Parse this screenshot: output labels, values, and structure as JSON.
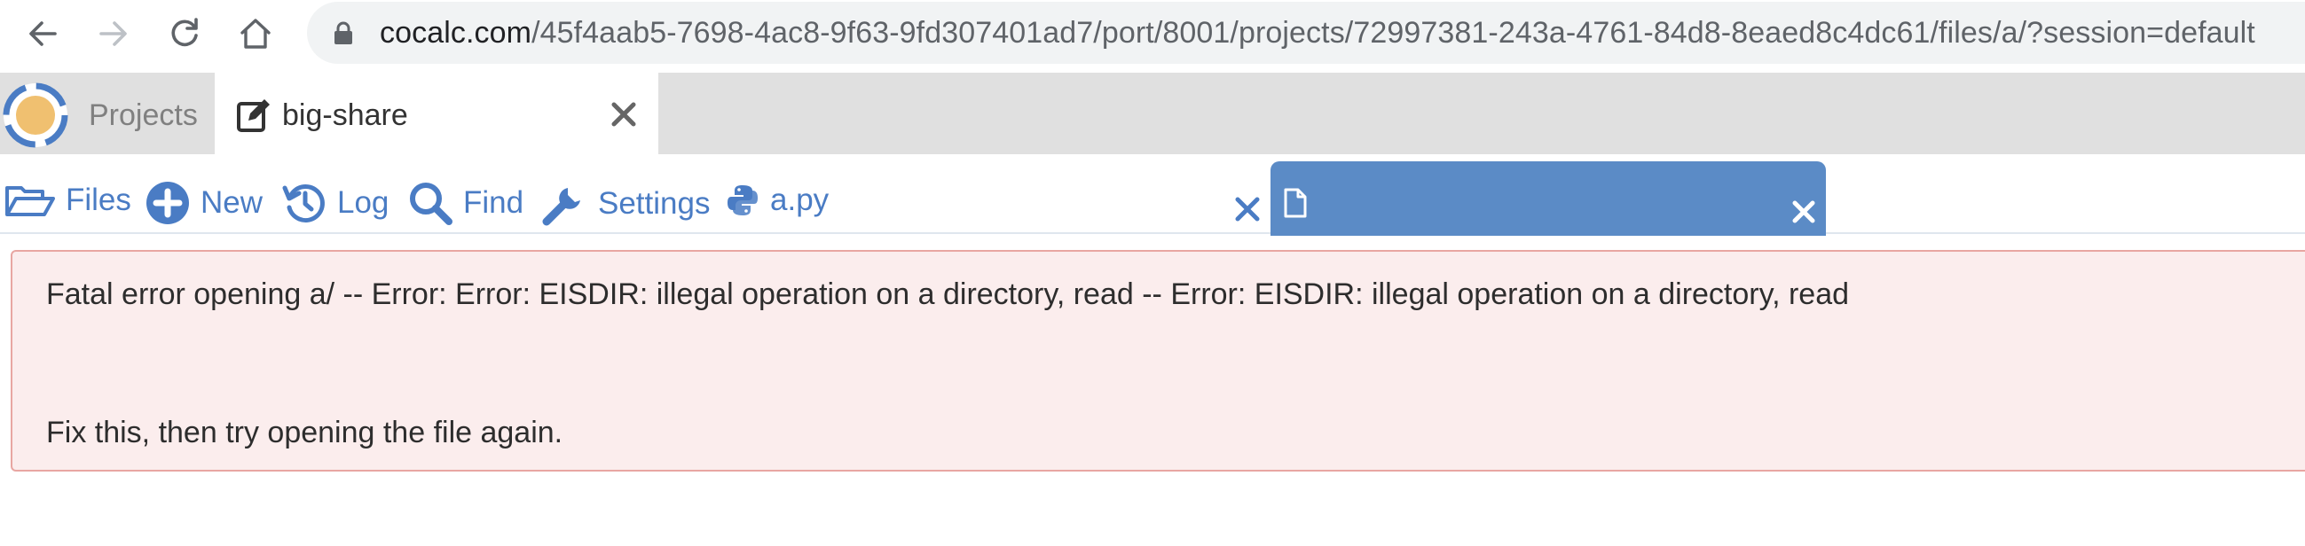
{
  "browser": {
    "url_host": "cocalc.com",
    "url_path": "/45f4aab5-7698-4ac8-9f63-9fd307401ad7/port/8001/projects/72997381-243a-4761-84d8-8eaed8c4dc61/files/a/?session=default",
    "icons": [
      "back-arrow-icon",
      "forward-arrow-icon",
      "reload-icon",
      "home-icon",
      "lock-icon"
    ]
  },
  "app_tabs": {
    "projects_label": "Projects",
    "project_tab_label": "big-share"
  },
  "toolbar": {
    "files_label": "Files",
    "new_label": "New",
    "log_label": "Log",
    "find_label": "Find",
    "settings_label": "Settings",
    "file_tab_label": "a.py",
    "active_tab_label": ""
  },
  "error": {
    "message": "Fatal error opening a/ -- Error: Error: EISDIR: illegal operation on a directory, read -- Error: EISDIR: illegal operation on a directory, read",
    "hint": "Fix this, then try opening the file again."
  },
  "colors": {
    "accent": "#4a7cc4",
    "active_tab": "#5b8bc6",
    "tabbar_bg": "#e0e0e0",
    "alert_bg": "#fbeded",
    "alert_border": "#e8a6a2",
    "logo_orange": "#f0c070"
  }
}
